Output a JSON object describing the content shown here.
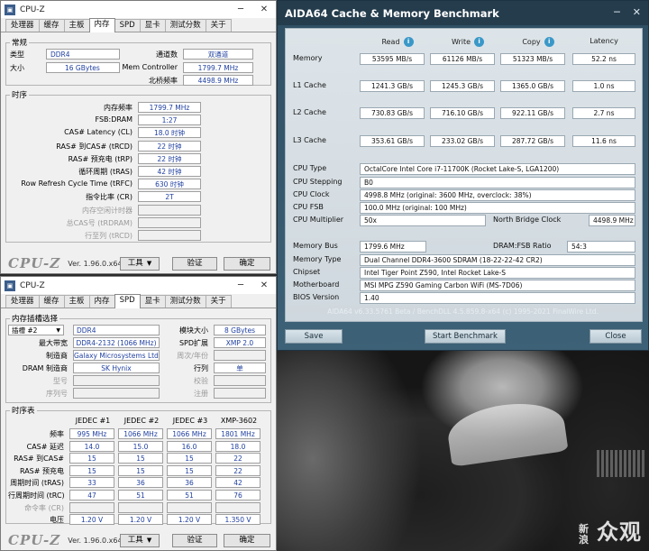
{
  "cpuz1": {
    "title": "CPU-Z",
    "tabs": [
      "处理器",
      "缓存",
      "主板",
      "内存",
      "SPD",
      "显卡",
      "测试分数",
      "关于"
    ],
    "active_tab": "内存",
    "general": {
      "legend": "常规",
      "type_label": "类型",
      "type_value": "DDR4",
      "size_label": "大小",
      "size_value": "16 GBytes",
      "channels_label": "通道数",
      "channels_value": "双通道",
      "memctrl_label": "Mem Controller",
      "memctrl_value": "1799.7 MHz",
      "nb_label": "北桥频率",
      "nb_value": "4498.9 MHz"
    },
    "timings": {
      "legend": "时序",
      "rows": [
        {
          "label": "内存频率",
          "value": "1799.7 MHz"
        },
        {
          "label": "FSB:DRAM",
          "value": "1:27"
        },
        {
          "label": "CAS# Latency (CL)",
          "value": "18.0 时钟"
        },
        {
          "label": "RAS# 到CAS# (tRCD)",
          "value": "22 时钟"
        },
        {
          "label": "RAS# 预充电 (tRP)",
          "value": "22 时钟"
        },
        {
          "label": "循环周期 (tRAS)",
          "value": "42 时钟"
        },
        {
          "label": "Row Refresh Cycle Time (tRFC)",
          "value": "630 时钟"
        },
        {
          "label": "指令比率 (CR)",
          "value": "2T"
        },
        {
          "label": "内存空闲计时器",
          "value": ""
        },
        {
          "label": "总CAS号 (tRDRAM)",
          "value": ""
        },
        {
          "label": "行至列 (tRCD)",
          "value": ""
        }
      ]
    },
    "logo": "CPU-Z",
    "version": "Ver. 1.96.0.x64",
    "tools_button": "工具",
    "validate_button": "验证",
    "ok_button": "确定"
  },
  "cpuz2": {
    "title": "CPU-Z",
    "tabs": [
      "处理器",
      "缓存",
      "主板",
      "内存",
      "SPD",
      "显卡",
      "测试分数",
      "关于"
    ],
    "active_tab": "SPD",
    "slot": {
      "legend": "内存插槽选择",
      "slot_select": "插槽 #2",
      "type_value": "DDR4",
      "module_size_label": "模块大小",
      "module_size_value": "8 GBytes",
      "max_bw_label": "最大带宽",
      "max_bw_value": "DDR4-2132 (1066 MHz)",
      "spd_ext_label": "SPD扩展",
      "spd_ext_value": "XMP 2.0",
      "maker_label": "制造商",
      "maker_value": "Galaxy Microsystems Ltd.",
      "weeks_label": "周次/年份",
      "weeks_value": "",
      "dram_maker_label": "DRAM 制造商",
      "dram_maker_value": "SK Hynix",
      "ranks_label": "行列",
      "ranks_value": "单",
      "part_label": "型号",
      "part_value": "",
      "check_label": "校验",
      "check_value": "",
      "serial_label": "序列号",
      "serial_value": "",
      "reg_label": "注册",
      "reg_value": ""
    },
    "timings": {
      "legend": "时序表",
      "columns": [
        "JEDEC #1",
        "JEDEC #2",
        "JEDEC #3",
        "XMP-3602"
      ],
      "rows": [
        {
          "label": "频率",
          "values": [
            "995 MHz",
            "1066 MHz",
            "1066 MHz",
            "1801 MHz"
          ]
        },
        {
          "label": "CAS# 延迟",
          "values": [
            "14.0",
            "15.0",
            "16.0",
            "18.0"
          ]
        },
        {
          "label": "RAS# 到CAS#",
          "values": [
            "15",
            "15",
            "15",
            "22"
          ]
        },
        {
          "label": "RAS# 预充电",
          "values": [
            "15",
            "15",
            "15",
            "22"
          ]
        },
        {
          "label": "周期时间 (tRAS)",
          "values": [
            "33",
            "36",
            "36",
            "42"
          ]
        },
        {
          "label": "行周期时间 (tRC)",
          "values": [
            "47",
            "51",
            "51",
            "76"
          ]
        },
        {
          "label": "命令率 (CR)",
          "values": [
            "",
            "",
            "",
            ""
          ]
        },
        {
          "label": "电压",
          "values": [
            "1.20 V",
            "1.20 V",
            "1.20 V",
            "1.350 V"
          ]
        }
      ]
    },
    "logo": "CPU-Z",
    "version": "Ver. 1.96.0.x64",
    "tools_button": "工具",
    "validate_button": "验证",
    "ok_button": "确定"
  },
  "aida": {
    "title": "AIDA64 Cache & Memory Benchmark",
    "col_read": "Read",
    "col_write": "Write",
    "col_copy": "Copy",
    "col_latency": "Latency",
    "bench": [
      {
        "label": "Memory",
        "read": "53595 MB/s",
        "write": "61126 MB/s",
        "copy": "51323 MB/s",
        "latency": "52.2 ns"
      },
      {
        "label": "L1 Cache",
        "read": "1241.3 GB/s",
        "write": "1245.3 GB/s",
        "copy": "1365.0 GB/s",
        "latency": "1.0 ns"
      },
      {
        "label": "L2 Cache",
        "read": "730.83 GB/s",
        "write": "716.10 GB/s",
        "copy": "922.11 GB/s",
        "latency": "2.7 ns"
      },
      {
        "label": "L3 Cache",
        "read": "353.61 GB/s",
        "write": "233.02 GB/s",
        "copy": "287.72 GB/s",
        "latency": "11.6 ns"
      }
    ],
    "cpu_type_label": "CPU Type",
    "cpu_type": "OctalCore Intel Core i7-11700K  (Rocket Lake-S, LGA1200)",
    "cpu_stepping_label": "CPU Stepping",
    "cpu_stepping": "B0",
    "cpu_clock_label": "CPU Clock",
    "cpu_clock": "4998.8 MHz  (original: 3600 MHz, overclock: 38%)",
    "cpu_fsb_label": "CPU FSB",
    "cpu_fsb": "100.0 MHz  (original: 100 MHz)",
    "cpu_mult_label": "CPU Multiplier",
    "cpu_mult": "50x",
    "nb_clock_label": "North Bridge Clock",
    "nb_clock": "4498.9 MHz",
    "mem_bus_label": "Memory Bus",
    "mem_bus": "1799.6 MHz",
    "dram_fsb_label": "DRAM:FSB Ratio",
    "dram_fsb": "54:3",
    "mem_type_label": "Memory Type",
    "mem_type": "Dual Channel DDR4-3600 SDRAM  (18-22-22-42 CR2)",
    "chipset_label": "Chipset",
    "chipset": "Intel Tiger Point Z590, Intel Rocket Lake-S",
    "motherboard_label": "Motherboard",
    "motherboard": "MSI MPG Z590 Gaming Carbon WiFi (MS-7D06)",
    "bios_label": "BIOS Version",
    "bios": "1.40",
    "footer": "AIDA64 v6.33.5761 Beta / BenchDLL 4.5.859.8-x64  (c) 1995-2021 FinalWire Ltd.",
    "save_button": "Save",
    "start_button": "Start Benchmark",
    "close_button": "Close"
  },
  "watermark": {
    "main": "众观",
    "sub": "新浪"
  }
}
